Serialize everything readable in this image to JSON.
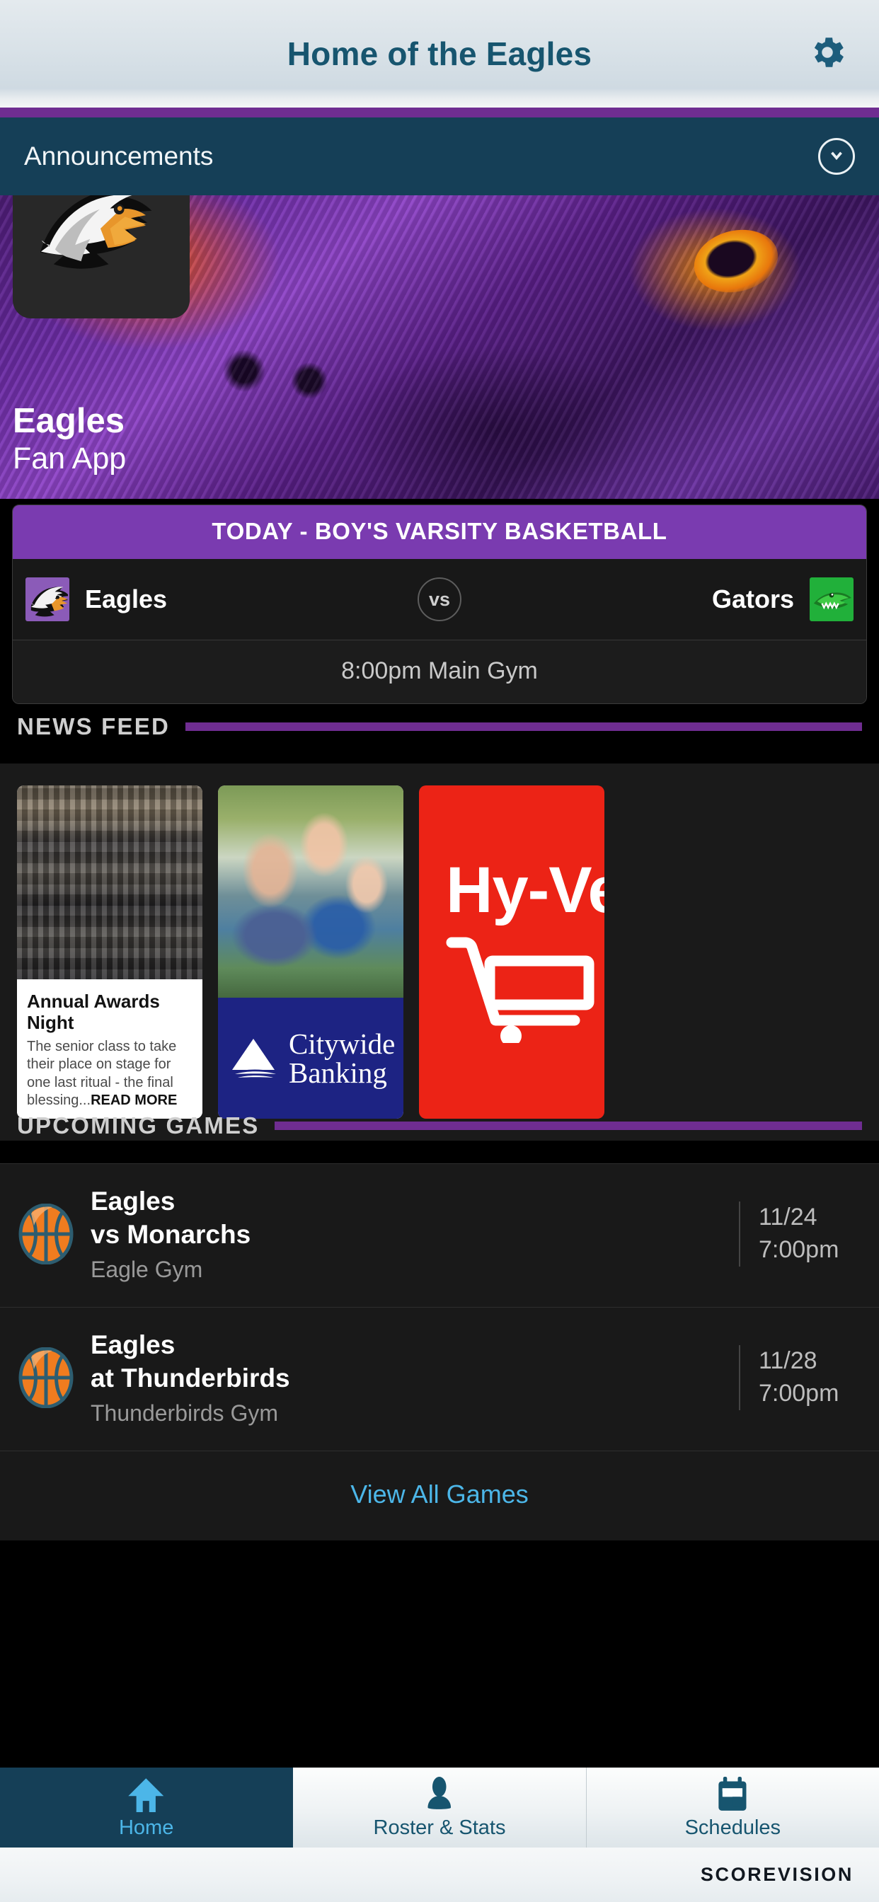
{
  "header": {
    "title": "Home of the Eagles",
    "settings_icon": "gear-icon"
  },
  "announcements": {
    "label": "Announcements",
    "toggle_icon": "chevron-down-icon"
  },
  "hero": {
    "team_name": "Eagles",
    "subtitle": "Fan App",
    "crest_icon": "eagle-head-logo"
  },
  "today_game": {
    "headline": "TODAY - BOY'S VARSITY BASKETBALL",
    "home_team": "Eagles",
    "away_team": "Gators",
    "vs_label": "vs",
    "details": "8:00pm Main Gym"
  },
  "news_feed": {
    "section_title": "NEWS FEED",
    "cards": [
      {
        "type": "article",
        "title": "Annual Awards Night",
        "excerpt": "The senior class to take their place on stage for one last ritual - the final blessing...",
        "read_more": "READ MORE",
        "photo_alt": "graduating-class-photo"
      },
      {
        "type": "ad",
        "photo_alt": "family-on-lawn-photo",
        "advertiser_line1": "Citywide",
        "advertiser_line2": "Banking",
        "brand_color": "#1d2383"
      },
      {
        "type": "ad",
        "advertiser_line1": "Hy-Vee",
        "brand_color": "#ec2316",
        "icon": "shopping-cart-icon"
      }
    ]
  },
  "upcoming_games": {
    "section_title": "UPCOMING GAMES",
    "view_all_label": "View All Games",
    "rows": [
      {
        "sport_icon": "basketball-icon",
        "team": "Eagles",
        "opponent": "vs Monarchs",
        "venue": "Eagle Gym",
        "date": "11/24",
        "time": "7:00pm"
      },
      {
        "sport_icon": "basketball-icon",
        "team": "Eagles",
        "opponent": "at Thunderbirds",
        "venue": "Thunderbirds Gym",
        "date": "11/28",
        "time": "7:00pm"
      }
    ]
  },
  "bottom_nav": {
    "items": [
      {
        "label": "Home",
        "icon": "home-icon",
        "active": true
      },
      {
        "label": "Roster & Stats",
        "icon": "person-icon",
        "active": false
      },
      {
        "label": "Schedules",
        "icon": "calendar-icon",
        "active": false
      }
    ]
  },
  "footer": {
    "brand": "SCOREVISION"
  },
  "colors": {
    "accent_purple": "#6f2d91",
    "header_teal": "#153f57",
    "link_blue": "#4cb6e8",
    "card_purple": "#7a3bb0"
  }
}
